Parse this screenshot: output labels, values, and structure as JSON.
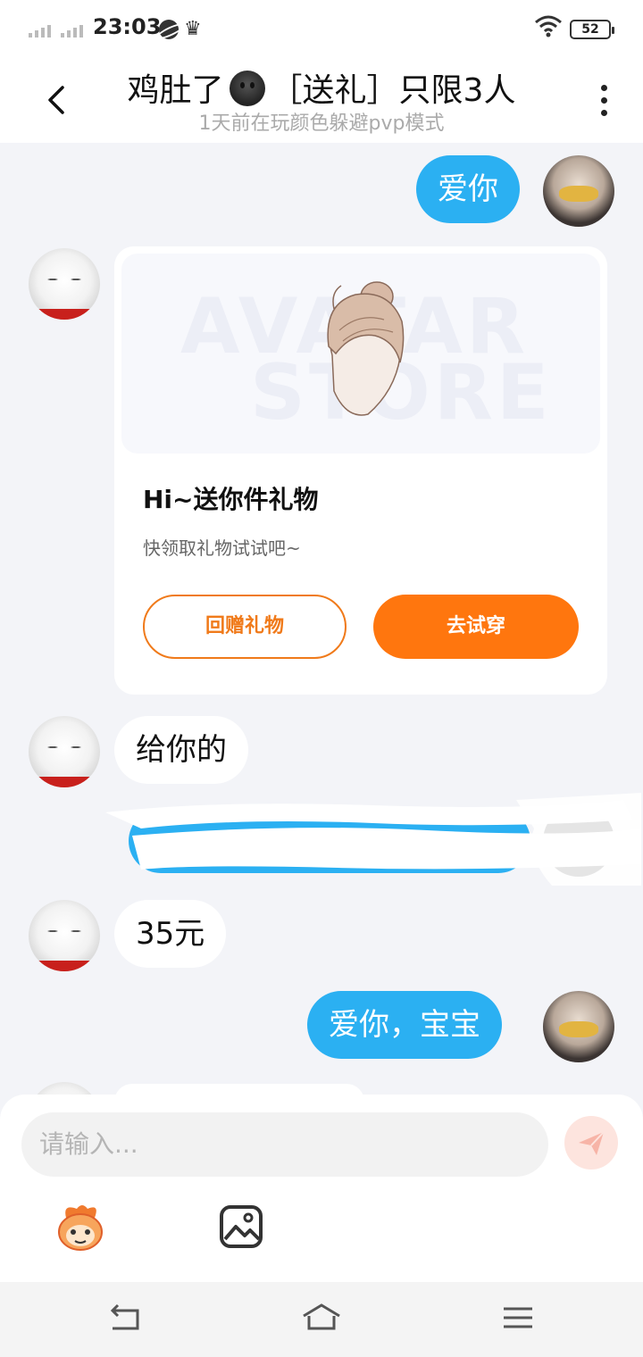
{
  "status_bar": {
    "time": "23:03",
    "battery": "52",
    "icons": [
      "signal-icon",
      "planet-icon",
      "crown-icon",
      "wifi-icon",
      "battery-icon"
    ]
  },
  "header": {
    "title_prefix": "鸡肚了",
    "title_suffix": "［送礼］只限3人",
    "subtitle": "1天前在玩颜色躲避pvp模式",
    "icons": [
      "back-icon",
      "emoji-icon",
      "more-icon"
    ]
  },
  "messages": [
    {
      "side": "out",
      "text": "爱你"
    },
    {
      "side": "in",
      "type": "gift-card"
    },
    {
      "side": "in",
      "text": "给你的"
    },
    {
      "side": "out",
      "type": "redacted"
    },
    {
      "side": "in",
      "text": "35元"
    },
    {
      "side": "out",
      "text": "爱你，宝宝"
    }
  ],
  "gift_card": {
    "watermark_top": "AVATAR",
    "watermark_bottom": "STORE",
    "title": "Hi~送你件礼物",
    "subtitle": "快领取礼物试试吧~",
    "return_button": "回赠礼物",
    "try_button": "去试穿"
  },
  "composer": {
    "placeholder": "请输入...",
    "icons": [
      "send-icon",
      "sticker-icon",
      "image-icon"
    ]
  },
  "nav": {
    "icons": [
      "nav-back-icon",
      "nav-home-icon",
      "nav-menu-icon"
    ]
  },
  "colors": {
    "bubble_out": "#2bb0f2",
    "accent_orange": "#ff760e",
    "background": "#f3f4f8"
  }
}
